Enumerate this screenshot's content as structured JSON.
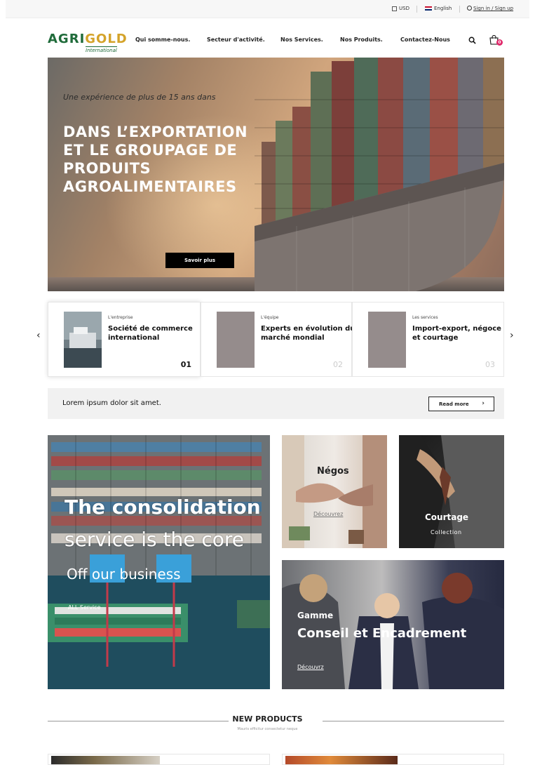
{
  "topbar": {
    "currency": "USD",
    "language": "English",
    "account": "Sign in / Sign up"
  },
  "header": {
    "logo_main_1": "AGRI",
    "logo_main_2": "GOLD",
    "logo_sub": "International",
    "nav": [
      "Qui somme-nous.",
      "Secteur d'activité.",
      "Nos Services.",
      "Nos Produits.",
      "Contactez-Nous"
    ],
    "cart_count": "0"
  },
  "hero": {
    "tagline": "Une expérience de plus de 15 ans dans",
    "headline": "DANS L’EXPORTATION ET LE GROUPAGE DE PRODUITS AGROALIMENTAIRES",
    "button": "Savoir plus"
  },
  "cards": [
    {
      "kicker": "L'entreprise",
      "title": "Société de commerce international",
      "num": "01"
    },
    {
      "kicker": "L'équipe",
      "title": "Experts en évolution du marché mondial",
      "num": "02"
    },
    {
      "kicker": "Les services",
      "title": "Import-export, négoce et courtage",
      "num": "03"
    }
  ],
  "banner": {
    "text": "Lorem ipsum dolor sit amet.",
    "button": "Read more"
  },
  "tiles": {
    "port": {
      "line1": "The consolidation",
      "line2": "service is the core",
      "line3": "Off our business",
      "link": "ALL Service"
    },
    "negos": {
      "label": "Négos",
      "link": "Découvrez"
    },
    "courtage": {
      "label": "Courtage",
      "sub": "Collection"
    },
    "conseil": {
      "kicker": "Gamme",
      "label": "Conseil et Encadrement",
      "link": "Découvrz"
    }
  },
  "new_products": {
    "title": "NEW PRODUCTS",
    "subtitle": "Mauris efficitur consectetur neque"
  },
  "colors": {
    "brand_green": "#1f6b3a",
    "brand_gold": "#d4a32a",
    "badge": "#e0286a"
  }
}
